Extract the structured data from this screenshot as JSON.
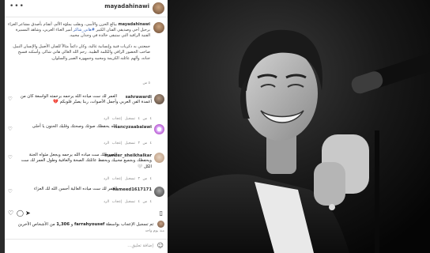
{
  "post": {
    "author": "mayadahinawi",
    "caption": {
      "handle": "mayadahinawi",
      "line1": "بيالغ الحزن والأسى، وبقلب يملؤه الألم، أتقدّم بأصدق",
      "line2": "مشاعر العزاء برحيل أخي وصديقي الفنان الكبير",
      "hashtag": "#هاني_شاكر",
      "line2b": "أمير الغناء العربي، وشاهد المسيرة الفنية الراقية التي ستبقى خالدة في وجدان محبيه.",
      "line3": "جمعتني به ذكريات فنية وإنسانية غالية، وكان دائماً مثالاً للفنان الأصيل والإنسان النبيل. صاحب الحضور الراقي والكلمة الطيبة.",
      "line4": "رحم الله الغالي هاني شاكر، وأسكنه فسيح جناته، وألهم عائلته الكريمة ومحبيه وجمهوره الصبر والسلوان.",
      "meta": "٥ س"
    },
    "comments": [
      {
        "handle": "sahrawardi",
        "text": "العمر لك ست مياده الله يرحمه برحمته الواسعة كان من أعمدة الفن العربي وأجمل الأصوات، ربنا يصبّر قلوبكم 💔",
        "meta": "٤ س   ٤ تسجيل إعجاب   الرد"
      },
      {
        "handle": "nancyzaabalawi",
        "text": "الله يحفظك صوتك وصحتك وقلبك الحنون يا أحلى",
        "meta": "٤ س   ٣ تسجيل إعجاب   الرد"
      },
      {
        "handle": "munzer_sheikhalkar",
        "text": "العمر الك ست مياده الله يرحمه ويجعل مثواه الجنة ويحفظك وبجميع محبيك وبحفظ عائلتك الصحة والعافية وطول العمر لك ست الكل 🤍",
        "meta": "٤ س   ٣ تسجيل إعجاب   الرد"
      },
      {
        "handle": "hameed1617171",
        "text": "العمر لك ست مياده الغالية أحسن الله لك العزاء",
        "meta": "٤ س   ٤ تسجيل إعجاب   الرد"
      }
    ],
    "likes": {
      "prefix": "تم تسجيل الإعجاب بواسطة",
      "user": "farrahyousef",
      "middle": "و",
      "count": "1,306",
      "suffix": "من الأشخاص الآخرين"
    },
    "date": "منذ يوم واحد",
    "add_comment_placeholder": "إضافة تعليق..."
  },
  "icons": {
    "more": "more-options-icon",
    "heart": "heart-icon",
    "comment": "comment-icon",
    "share": "share-icon",
    "save": "bookmark-icon",
    "emoji": "emoji-icon"
  }
}
